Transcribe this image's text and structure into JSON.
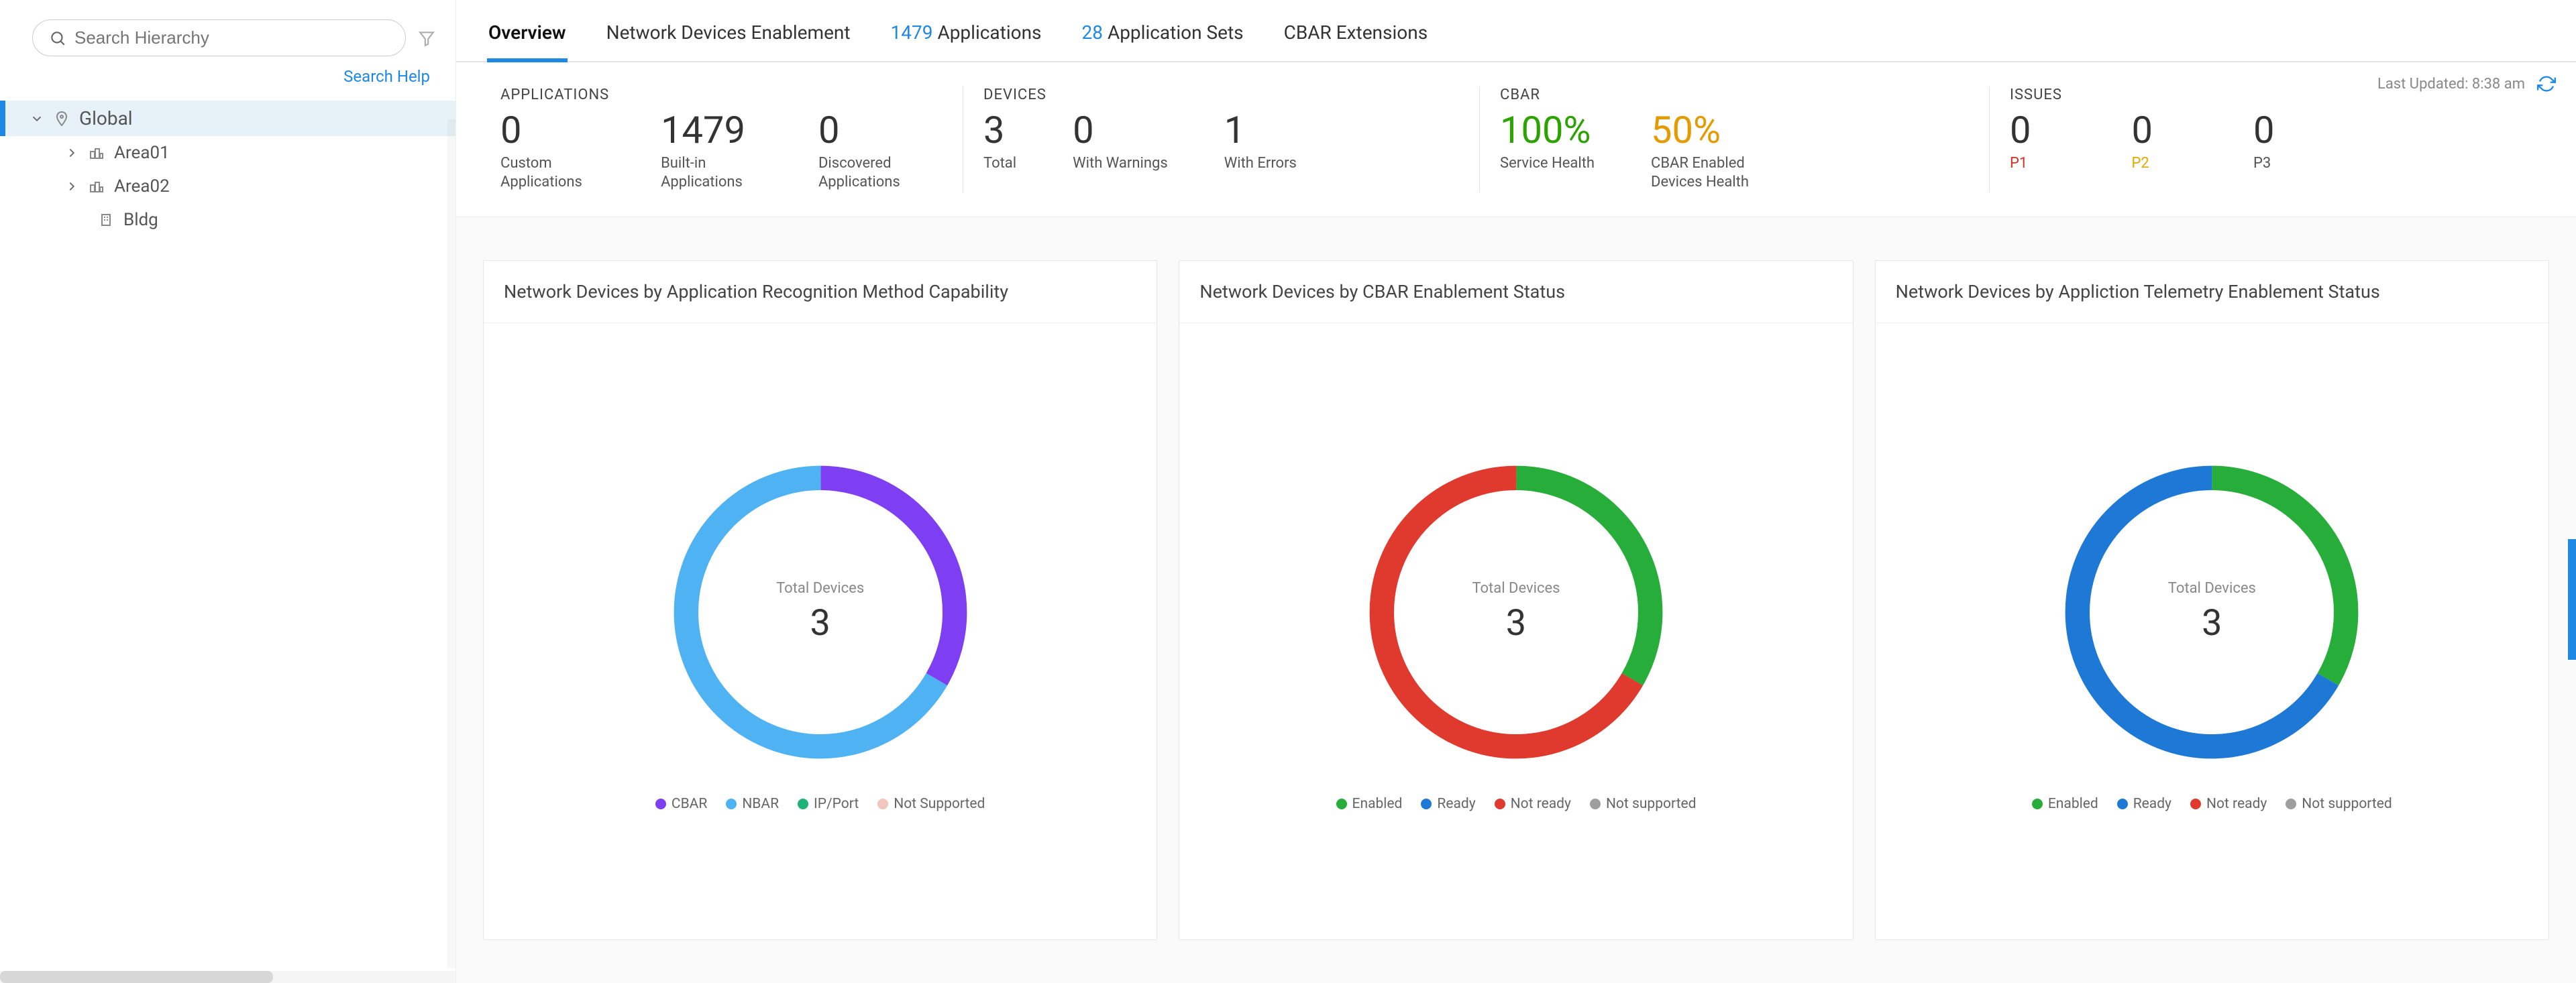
{
  "sidebar": {
    "search_placeholder": "Search Hierarchy",
    "search_help": "Search Help",
    "tree": {
      "root": "Global",
      "nodes": [
        "Area01",
        "Area02",
        "Bldg"
      ]
    }
  },
  "tabs": {
    "overview": "Overview",
    "nde": "Network Devices Enablement",
    "apps_count": "1479",
    "apps_label": " Applications",
    "sets_count": "28",
    "sets_label": " Application Sets",
    "cbar_ext": "CBAR Extensions"
  },
  "last_updated": "Last Updated: 8:38 am",
  "summary": {
    "applications": {
      "title": "APPLICATIONS",
      "custom": {
        "value": "0",
        "label": "Custom Applications"
      },
      "builtin": {
        "value": "1479",
        "label": "Built-in Applications"
      },
      "discovered": {
        "value": "0",
        "label": "Discovered Applications"
      }
    },
    "devices": {
      "title": "DEVICES",
      "total": {
        "value": "3",
        "label": "Total"
      },
      "warnings": {
        "value": "0",
        "label": "With Warnings"
      },
      "errors": {
        "value": "1",
        "label": "With Errors"
      }
    },
    "cbar": {
      "title": "CBAR",
      "service": {
        "value": "100%",
        "label": "Service Health"
      },
      "enabled": {
        "value": "50%",
        "label": "CBAR Enabled Devices Health"
      }
    },
    "issues": {
      "title": "ISSUES",
      "p1": {
        "value": "0",
        "label": "P1"
      },
      "p2": {
        "value": "0",
        "label": "P2"
      },
      "p3": {
        "value": "0",
        "label": "P3"
      }
    }
  },
  "cards": {
    "center_label": "Total Devices",
    "c1": {
      "title": "Network Devices by Application Recognition Method Capability",
      "total": "3",
      "legend": [
        {
          "label": "CBAR",
          "color": "#7e3ff2"
        },
        {
          "label": "NBAR",
          "color": "#4fb3f3"
        },
        {
          "label": "IP/Port",
          "color": "#1fb378"
        },
        {
          "label": "Not Supported",
          "color": "#f2c6bd"
        }
      ]
    },
    "c2": {
      "title": "Network Devices by CBAR Enablement Status",
      "total": "3",
      "legend": [
        {
          "label": "Enabled",
          "color": "#27ae3a"
        },
        {
          "label": "Ready",
          "color": "#1e78d6"
        },
        {
          "label": "Not ready",
          "color": "#e0392d"
        },
        {
          "label": "Not supported",
          "color": "#9e9e9e"
        }
      ]
    },
    "c3": {
      "title": "Network Devices by Appliction Telemetry Enablement Status",
      "total": "3",
      "legend": [
        {
          "label": "Enabled",
          "color": "#27ae3a"
        },
        {
          "label": "Ready",
          "color": "#1e78d6"
        },
        {
          "label": "Not ready",
          "color": "#e0392d"
        },
        {
          "label": "Not supported",
          "color": "#9e9e9e"
        }
      ]
    }
  },
  "chart_data": [
    {
      "type": "pie",
      "title": "Network Devices by Application Recognition Method Capability",
      "total": 3,
      "series": [
        {
          "name": "CBAR",
          "value": 1,
          "color": "#7e3ff2"
        },
        {
          "name": "NBAR",
          "value": 2,
          "color": "#4fb3f3"
        },
        {
          "name": "IP/Port",
          "value": 0,
          "color": "#1fb378"
        },
        {
          "name": "Not Supported",
          "value": 0,
          "color": "#f2c6bd"
        }
      ]
    },
    {
      "type": "pie",
      "title": "Network Devices by CBAR Enablement Status",
      "total": 3,
      "series": [
        {
          "name": "Enabled",
          "value": 1,
          "color": "#27ae3a"
        },
        {
          "name": "Ready",
          "value": 0,
          "color": "#1e78d6"
        },
        {
          "name": "Not ready",
          "value": 2,
          "color": "#e0392d"
        },
        {
          "name": "Not supported",
          "value": 0,
          "color": "#9e9e9e"
        }
      ]
    },
    {
      "type": "pie",
      "title": "Network Devices by Appliction Telemetry Enablement Status",
      "total": 3,
      "series": [
        {
          "name": "Enabled",
          "value": 1,
          "color": "#27ae3a"
        },
        {
          "name": "Ready",
          "value": 2,
          "color": "#1e78d6"
        },
        {
          "name": "Not ready",
          "value": 0,
          "color": "#e0392d"
        },
        {
          "name": "Not supported",
          "value": 0,
          "color": "#9e9e9e"
        }
      ]
    }
  ]
}
